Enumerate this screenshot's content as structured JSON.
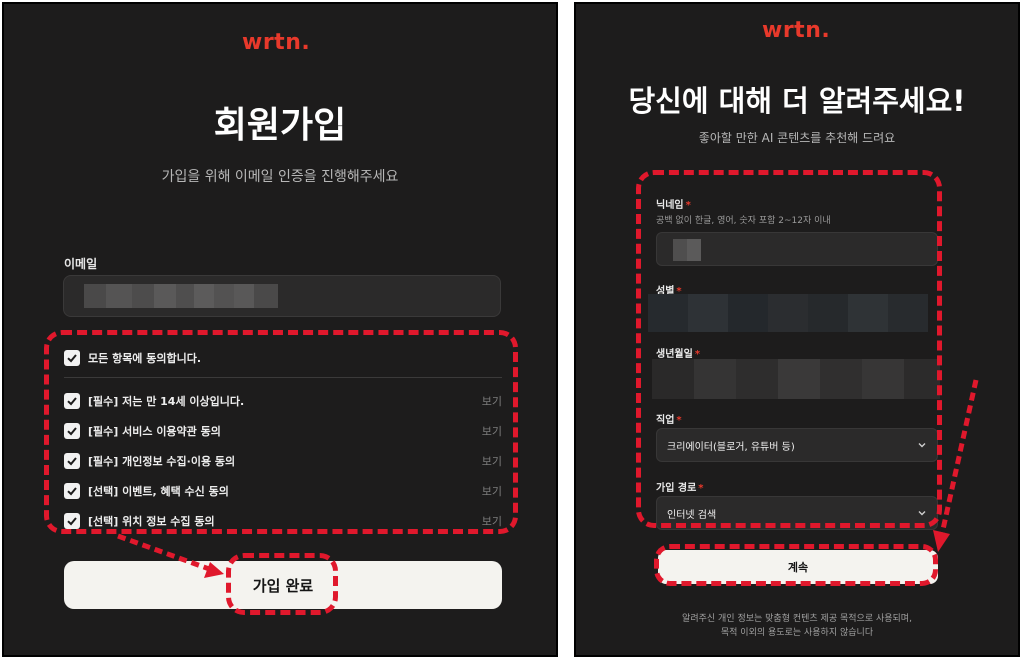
{
  "colors": {
    "background": "#1d1c1c",
    "brand": "#e8392b",
    "button": "#f4f3ef",
    "annotation": "#e0182c"
  },
  "left": {
    "logo": "wrtn.",
    "title": "회원가입",
    "subtitle": "가입을 위해 이메일 인증을 진행해주세요",
    "email_label": "이메일",
    "agree_all": "모든 항목에 동의합니다.",
    "agreements": [
      {
        "label": "[필수] 저는 만 14세 이상입니다.",
        "view": "보기"
      },
      {
        "label": "[필수] 서비스 이용약관 동의",
        "view": "보기"
      },
      {
        "label": "[필수] 개인정보 수집·이용 동의",
        "view": "보기"
      },
      {
        "label": "[선택] 이벤트, 혜택 수신 동의",
        "view": "보기"
      },
      {
        "label": "[선택] 위치 정보 수집 동의",
        "view": "보기"
      }
    ],
    "submit": "가입 완료"
  },
  "right": {
    "logo": "wrtn.",
    "title": "당신에 대해 더 알려주세요!",
    "subtitle": "좋아할 만한 AI 콘텐츠를 추천해 드려요",
    "nickname_label": "닉네임",
    "nickname_help": "공백 없이 한글, 영어, 숫자 포함 2~12자 이내",
    "gender_label": "성별",
    "birth_label": "생년월일",
    "job_label": "직업",
    "job_value": "크리에이터(블로거, 유튜버 등)",
    "source_label": "가입 경로",
    "source_value": "인터넷 검색",
    "required_mark": "*",
    "continue": "계속",
    "footer_line1": "알려주신 개인 정보는 맞춤형 컨텐츠 제공 목적으로 사용되며,",
    "footer_line2": "목적 이외의 용도로는 사용하지 않습니다"
  }
}
